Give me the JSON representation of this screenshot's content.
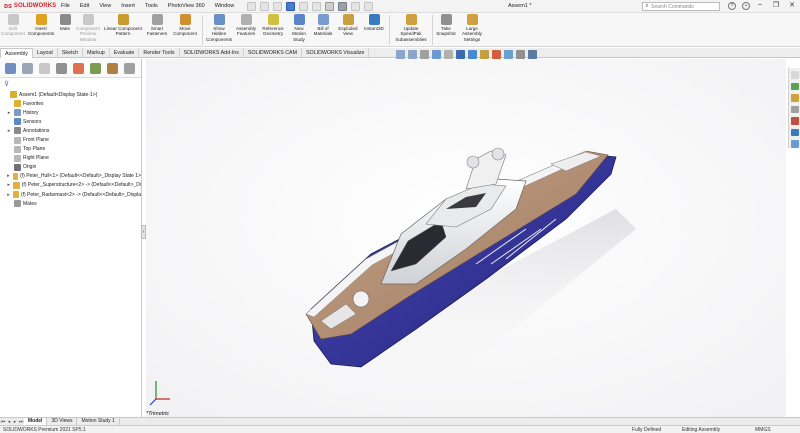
{
  "app": {
    "brand": "SOLIDWORKS",
    "document_title": "Assem1 *"
  },
  "menu": [
    "File",
    "Edit",
    "View",
    "Insert",
    "Tools",
    "PhotoView 360",
    "Window"
  ],
  "search": {
    "placeholder": "Search Commands"
  },
  "ribbon": [
    {
      "label": "Edit\nComponent",
      "disabled": true,
      "icon": "edit-component-icon",
      "color": "#b8b8b8"
    },
    {
      "label": "Insert\nComponents",
      "disabled": false,
      "icon": "insert-components-icon",
      "color": "#e0a020"
    },
    {
      "label": "Mate",
      "disabled": false,
      "icon": "mate-icon",
      "color": "#8a8a8a"
    },
    {
      "label": "Component\nPreview\nWindow",
      "disabled": true,
      "icon": "component-preview-icon",
      "color": "#b8b8b8"
    },
    {
      "label": "Linear Component\nPattern",
      "disabled": false,
      "icon": "linear-pattern-icon",
      "color": "#c89a30"
    },
    {
      "label": "Smart\nFasteners",
      "disabled": false,
      "icon": "smart-fasteners-icon",
      "color": "#a0a0a0"
    },
    {
      "label": "Move\nComponent",
      "disabled": false,
      "icon": "move-component-icon",
      "color": "#d09030"
    },
    {
      "label": "Show\nHidden\nComponents",
      "disabled": false,
      "icon": "show-hidden-icon",
      "color": "#6a8fc8"
    },
    {
      "label": "Assembly\nFeatures",
      "disabled": false,
      "icon": "assembly-features-icon",
      "color": "#b0b0b0"
    },
    {
      "label": "Reference\nGeometry",
      "disabled": false,
      "icon": "reference-geometry-icon",
      "color": "#d0c040"
    },
    {
      "label": "New\nMotion\nStudy",
      "disabled": false,
      "icon": "motion-study-icon",
      "color": "#5b85c9"
    },
    {
      "label": "Bill of\nMaterials",
      "disabled": false,
      "icon": "bom-icon",
      "color": "#7a9bd0"
    },
    {
      "label": "Exploded\nView",
      "disabled": false,
      "icon": "exploded-view-icon",
      "color": "#c8a040"
    },
    {
      "label": "Instant3D",
      "disabled": false,
      "icon": "instant3d-icon",
      "color": "#3a7ac0"
    },
    {
      "label": "Update\nSpeedPak\nSubassemblies",
      "disabled": false,
      "icon": "speedpak-icon",
      "color": "#d0a040"
    },
    {
      "label": "Take\nSnapshot",
      "disabled": false,
      "icon": "snapshot-icon",
      "color": "#909090"
    },
    {
      "label": "Large\nAssembly\nSettings",
      "disabled": false,
      "icon": "large-assembly-icon",
      "color": "#d0a040"
    }
  ],
  "tabs": [
    "Assembly",
    "Layout",
    "Sketch",
    "Markup",
    "Evaluate",
    "Render Tools",
    "SOLIDWORKS Add-Ins",
    "SOLIDWORKS CAM",
    "SOLIDWORKS Visualize"
  ],
  "active_tab": "Assembly",
  "feature_tree": [
    {
      "label": "Assem1  (Default<Display State-1>)",
      "expander": "",
      "icon": "assembly-icon",
      "color": "#d8b030",
      "indent": 0
    },
    {
      "label": "Favorites",
      "expander": "",
      "icon": "favorites-icon",
      "color": "#e0b030",
      "indent": 1
    },
    {
      "label": "History",
      "expander": "▸",
      "icon": "history-icon",
      "color": "#7a9bc8",
      "indent": 1
    },
    {
      "label": "Sensors",
      "expander": "",
      "icon": "sensors-icon",
      "color": "#5a8ac0",
      "indent": 1
    },
    {
      "label": "Annotations",
      "expander": "▸",
      "icon": "annotations-icon",
      "color": "#8a8a8a",
      "indent": 1
    },
    {
      "label": "Front Plane",
      "expander": "",
      "icon": "plane-icon",
      "color": "#b8b8b8",
      "indent": 1
    },
    {
      "label": "Top Plane",
      "expander": "",
      "icon": "plane-icon",
      "color": "#b8b8b8",
      "indent": 1
    },
    {
      "label": "Right Plane",
      "expander": "",
      "icon": "plane-icon",
      "color": "#b8b8b8",
      "indent": 1
    },
    {
      "label": "Origin",
      "expander": "",
      "icon": "origin-icon",
      "color": "#707070",
      "indent": 1
    },
    {
      "label": "(f) Peter_Hull<1> (Default<<Default>_Display State 1>",
      "expander": "▸",
      "icon": "part-icon",
      "color": "#e0b040",
      "indent": 1
    },
    {
      "label": "(f) Peter_Superstructure<2> -> (Default<<Default>_Di",
      "expander": "▸",
      "icon": "part-icon",
      "color": "#e0b040",
      "indent": 1
    },
    {
      "label": "(f) Peter_Radarmast<2> -> (Default<<Default>_Displa",
      "expander": "▸",
      "icon": "part-icon",
      "color": "#e0b040",
      "indent": 1
    },
    {
      "label": "Mates",
      "expander": "",
      "icon": "mates-icon",
      "color": "#9a9a9a",
      "indent": 1
    }
  ],
  "viewport": {
    "view_label": "*Trimetric"
  },
  "bottom_tabs": [
    "Model",
    "3D Views",
    "Motion Study 1"
  ],
  "active_bottom_tab": "Model",
  "status": {
    "product": "SOLIDWORKS Premium 2021 SP5.1",
    "state": "Fully Defined",
    "mode": "Editing Assembly",
    "units": "MMGS"
  },
  "colors": {
    "brand": "#d2232a",
    "hull_blue": "#3a3aa0",
    "deck_wood": "#b08a6a"
  }
}
